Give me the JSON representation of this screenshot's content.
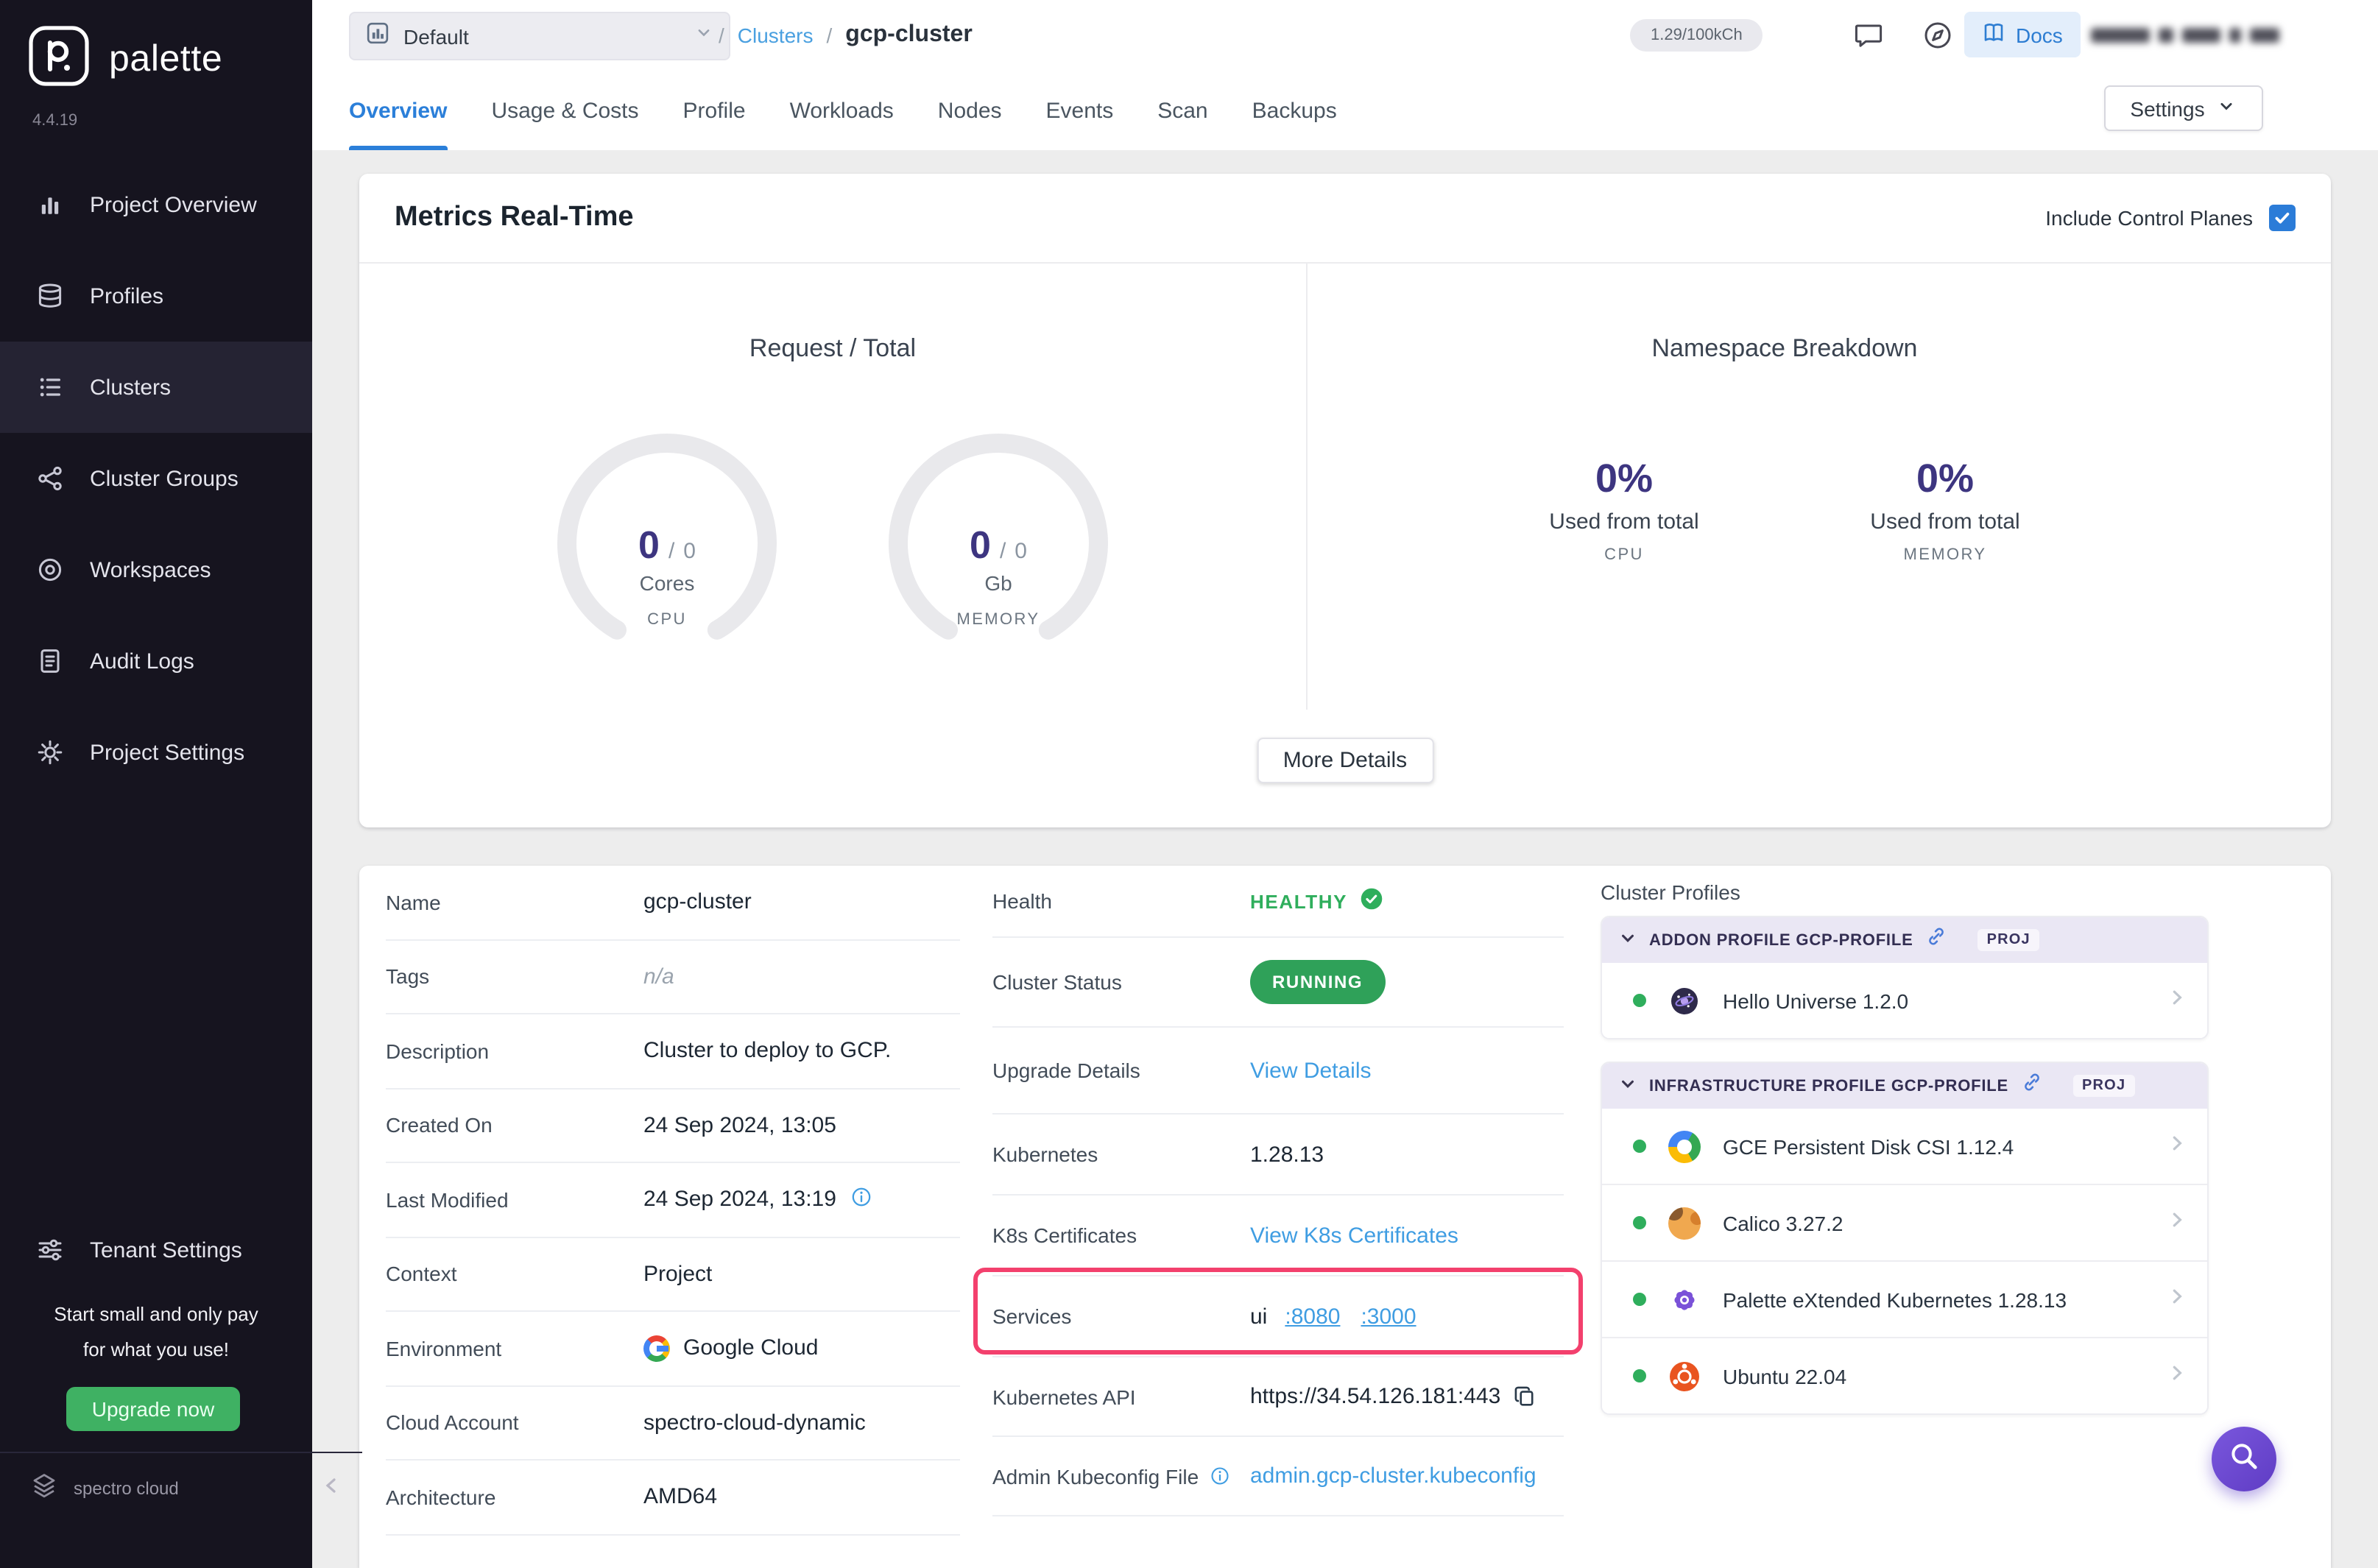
{
  "colors": {
    "accent_blue": "#3f9de2",
    "active_tab_blue": "#2b7fd9",
    "healthy_green": "#2fae5c",
    "running_green": "#2fa159",
    "upgrade_green": "#3fb163",
    "highlight_pink": "#f3406d",
    "fab_purple": "#6d49cf",
    "stat_purple": "#3d3580",
    "sidebar_bg": "#16141f"
  },
  "sidebar": {
    "brand": "palette",
    "version": "4.4.19",
    "items": [
      {
        "label": "Project Overview",
        "icon": "bar-chart"
      },
      {
        "label": "Profiles",
        "icon": "layers"
      },
      {
        "label": "Clusters",
        "icon": "list"
      },
      {
        "label": "Cluster Groups",
        "icon": "nodes"
      },
      {
        "label": "Workspaces",
        "icon": "rings"
      },
      {
        "label": "Audit Logs",
        "icon": "document"
      },
      {
        "label": "Project Settings",
        "icon": "gear"
      }
    ],
    "active_item": "Clusters",
    "tenant_settings_label": "Tenant Settings",
    "promo_line1": "Start small and only pay",
    "promo_line2": "for what you use!",
    "upgrade_label": "Upgrade now",
    "footer_brand": "spectro cloud"
  },
  "header": {
    "project_selector_value": "Default",
    "breadcrumb_sep1": "/",
    "breadcrumb_parent": "Clusters",
    "breadcrumb_sep2": "/",
    "breadcrumb_current": "gcp-cluster",
    "usage_counter": "1.29/100kCh",
    "docs_label": "Docs"
  },
  "tabs": {
    "items": [
      "Overview",
      "Usage & Costs",
      "Profile",
      "Workloads",
      "Nodes",
      "Events",
      "Scan",
      "Backups"
    ],
    "active": "Overview",
    "settings_label": "Settings"
  },
  "metrics": {
    "title": "Metrics Real-Time",
    "include_control_planes_label": "Include Control Planes",
    "include_control_planes_checked": true,
    "request_total": {
      "title": "Request / Total",
      "gauges": [
        {
          "value": "0",
          "separator": "/",
          "total": "0",
          "unit": "Cores",
          "metric": "CPU"
        },
        {
          "value": "0",
          "separator": "/",
          "total": "0",
          "unit": "Gb",
          "metric": "MEMORY"
        }
      ]
    },
    "namespace_breakdown": {
      "title": "Namespace Breakdown",
      "stats": [
        {
          "percent": "0%",
          "caption": "Used from total",
          "metric": "CPU"
        },
        {
          "percent": "0%",
          "caption": "Used from total",
          "metric": "MEMORY"
        }
      ]
    },
    "more_details_label": "More Details"
  },
  "details": {
    "left": [
      {
        "label": "Name",
        "value": "gcp-cluster"
      },
      {
        "label": "Tags",
        "value": "n/a"
      },
      {
        "label": "Description",
        "value": "Cluster to deploy to GCP."
      },
      {
        "label": "Created On",
        "value": "24 Sep 2024, 13:05"
      },
      {
        "label": "Last Modified",
        "value": "24 Sep 2024, 13:19"
      },
      {
        "label": "Context",
        "value": "Project"
      },
      {
        "label": "Environment",
        "value": "Google Cloud"
      },
      {
        "label": "Cloud Account",
        "value": "spectro-cloud-dynamic"
      },
      {
        "label": "Architecture",
        "value": "AMD64"
      }
    ],
    "health_label": "Health",
    "health_value": "HEALTHY",
    "status_label": "Cluster Status",
    "status_value": "RUNNING",
    "upgrade_label": "Upgrade Details",
    "upgrade_link": "View Details",
    "kubernetes_label": "Kubernetes",
    "kubernetes_value": "1.28.13",
    "certificates_label": "K8s Certificates",
    "certificates_link": "View K8s Certificates",
    "services_label": "Services",
    "services_prefix": "ui",
    "services_ports": [
      ":8080",
      ":3000"
    ],
    "api_label": "Kubernetes API",
    "api_value": "https://34.54.126.181:443",
    "kubeconfig_label": "Admin Kubeconfig File",
    "kubeconfig_link": "admin.gcp-cluster.kubeconfig"
  },
  "cluster_profiles": {
    "title": "Cluster Profiles",
    "groups": [
      {
        "header": "ADDON PROFILE GCP-PROFILE",
        "badge": "PROJ",
        "items": [
          {
            "name": "Hello Universe 1.2.0",
            "icon": "hello-universe"
          }
        ]
      },
      {
        "header": "INFRASTRUCTURE PROFILE GCP-PROFILE",
        "badge": "PROJ",
        "items": [
          {
            "name": "GCE Persistent Disk CSI 1.12.4",
            "icon": "gce-disk"
          },
          {
            "name": "Calico 3.27.2",
            "icon": "calico"
          },
          {
            "name": "Palette eXtended Kubernetes 1.28.13",
            "icon": "palette-k8s"
          },
          {
            "name": "Ubuntu 22.04",
            "icon": "ubuntu"
          }
        ]
      }
    ]
  }
}
